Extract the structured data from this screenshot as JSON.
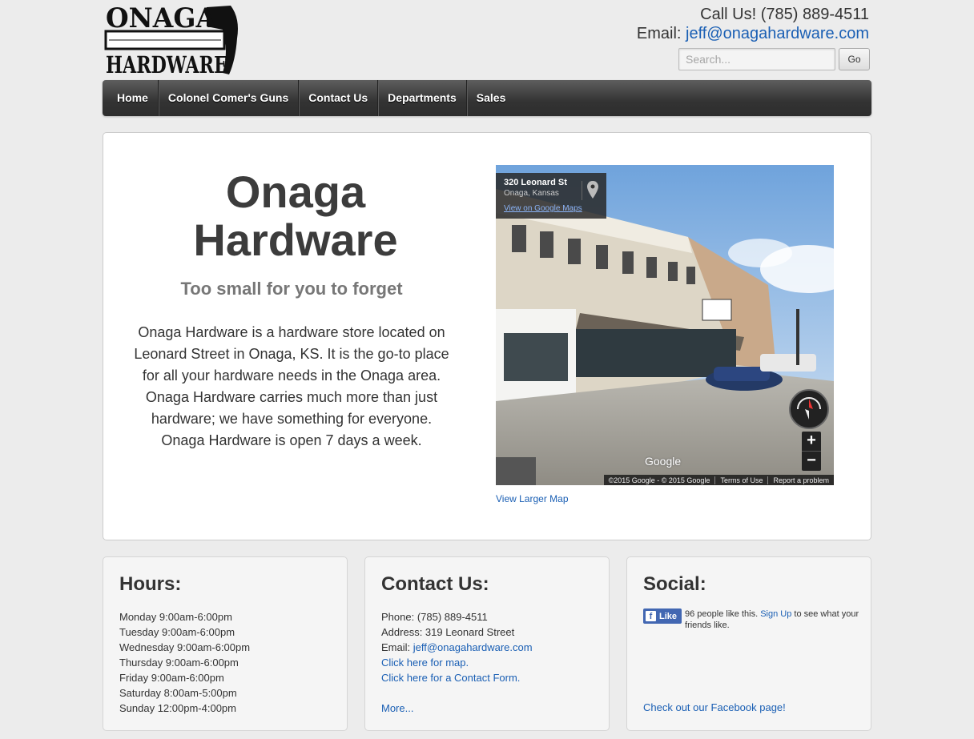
{
  "header": {
    "logo_line1": "ONAGA",
    "logo_line2": "HARDWARE",
    "call_label": "Call Us! (785) 889-4511",
    "email_label": "Email:",
    "email": "jeff@onagahardware.com",
    "search_placeholder": "Search...",
    "search_button": "Go"
  },
  "nav": {
    "items": [
      "Home",
      "Colonel Comer's Guns",
      "Contact Us",
      "Departments",
      "Sales"
    ]
  },
  "hero": {
    "title": "Onaga Hardware",
    "subtitle": "Too small for you to forget",
    "body": "Onaga Hardware is a hardware store located on Leonard Street in Onaga, KS. It is the go-to place for all your hardware needs in the Onaga area. Onaga Hardware carries much more than just hardware; we have something for everyone. Onaga Hardware is open 7 days a week.",
    "map": {
      "street": "320 Leonard St",
      "city": "Onaga, Kansas",
      "view_link": "View on Google Maps",
      "google": "Google",
      "zoom_in": "+",
      "zoom_out": "−",
      "copyright": "©2015 Google - © 2015 Google",
      "terms": "Terms of Use",
      "report": "Report a problem"
    },
    "larger_map": "View Larger Map"
  },
  "hours": {
    "title": "Hours:",
    "lines": [
      "Monday 9:00am-6:00pm",
      "Tuesday 9:00am-6:00pm",
      "Wednesday 9:00am-6:00pm",
      "Thursday 9:00am-6:00pm",
      "Friday 9:00am-6:00pm",
      "Saturday 8:00am-5:00pm",
      "Sunday 12:00pm-4:00pm"
    ]
  },
  "contact": {
    "title": "Contact Us:",
    "phone": "Phone: (785) 889-4511",
    "address": "Address: 319 Leonard Street",
    "email_label": "Email:",
    "email": "jeff@onagahardware.com",
    "map_link": "Click here for map.",
    "form_link": "Click here for a Contact Form.",
    "more": "More..."
  },
  "social": {
    "title": "Social:",
    "like": "Like",
    "likes_text": "96 people like this.",
    "signup": "Sign Up",
    "signup_rest": "to see what your friends like.",
    "fb_page": "Check out our Facebook page!"
  }
}
